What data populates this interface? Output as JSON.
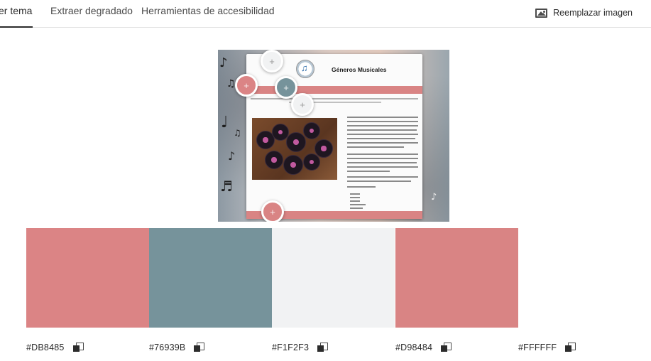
{
  "tabs": [
    {
      "label": "er tema",
      "active": true
    },
    {
      "label": "Extraer degradado",
      "active": false
    },
    {
      "label": "Herramientas de accesibilidad",
      "active": false
    }
  ],
  "replace_image": {
    "label": "Reemplazar imagen",
    "icon": "image-icon"
  },
  "source_image": {
    "page_title": "Géneros Musicales",
    "footer_text": "Derechos reservados / lista de enlaces musicales"
  },
  "colors": {
    "accent": "#DB8485",
    "slate": "#76939B",
    "light": "#F1F2F3",
    "accent2": "#D98484",
    "white": "#FFFFFF"
  },
  "swatches": [
    {
      "hex": "#DB8485",
      "copy_icon": "copy-icon"
    },
    {
      "hex": "#76939B",
      "copy_icon": "copy-icon"
    },
    {
      "hex": "#F1F2F3",
      "copy_icon": "copy-icon"
    },
    {
      "hex": "#D98484",
      "copy_icon": "copy-icon"
    },
    {
      "hex": "#FFFFFF",
      "copy_icon": "copy-icon"
    }
  ],
  "picker_symbol": "+"
}
